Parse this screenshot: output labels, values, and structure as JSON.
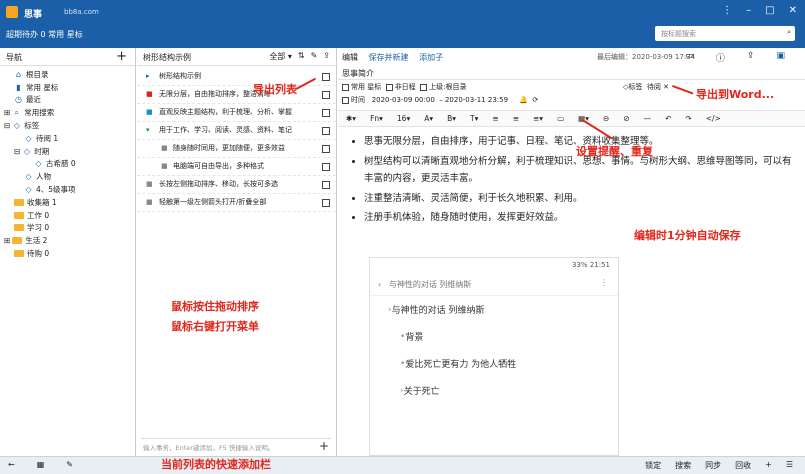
{
  "app": {
    "name": "思事",
    "domain": "bb8a.com",
    "links": "超期待办 0  常用 星标",
    "search_placeholder": "按标题搜索"
  },
  "left": {
    "header": "导航",
    "items": [
      {
        "icon": "home-icon",
        "label": "根目录",
        "indent": 1
      },
      {
        "icon": "bookmark-icon",
        "label": "常用 星标",
        "indent": 1
      },
      {
        "icon": "recent-icon",
        "label": "最近",
        "indent": 1
      },
      {
        "icon": "search-icon",
        "label": "常用搜索",
        "indent": 0,
        "prefix": "⊞"
      },
      {
        "icon": "tag-icon",
        "label": "标签",
        "indent": 0,
        "prefix": "⊟"
      },
      {
        "icon": "tag-icon",
        "label": "待阅 1",
        "indent": 2
      },
      {
        "icon": "tag-icon",
        "label": "时期",
        "indent": 1,
        "prefix": "⊟"
      },
      {
        "icon": "tag-icon",
        "label": "古希腊 0",
        "indent": 3
      },
      {
        "icon": "tag-icon",
        "label": "人物",
        "indent": 2
      },
      {
        "icon": "tag-icon",
        "label": "4、5级事项",
        "indent": 2
      },
      {
        "icon": "folder-icon",
        "label": "收集箱 1",
        "indent": 1
      },
      {
        "icon": "folder-icon",
        "label": "工作 0",
        "indent": 1
      },
      {
        "icon": "folder-icon",
        "label": "学习 0",
        "indent": 1
      },
      {
        "icon": "folder-icon",
        "label": "生活 2",
        "indent": 0,
        "prefix": "⊞"
      },
      {
        "icon": "folder-icon",
        "label": "待购 0",
        "indent": 1
      }
    ]
  },
  "mid": {
    "header": "树形结构示例",
    "filter": "全部 ▾",
    "quick_add_placeholder": "输入事务，Enter键添加，F5 快捷输入说明。",
    "rows": [
      {
        "bullet": "▸",
        "color": "#1a5fa8",
        "text": "树形结构示例",
        "indent": 0
      },
      {
        "bullet": "■",
        "color": "#d22",
        "text": "无限分层，自由拖动排序，整洁清晰",
        "indent": 0
      },
      {
        "bullet": "■",
        "color": "#1a8fd2",
        "text": "直观反映主题结构，利于梳理、分析、掌握",
        "indent": 0
      },
      {
        "bullet": "▾",
        "color": "#2a8a2a",
        "text": "用于工作、学习、阅读、灵感、资料、笔记",
        "indent": 0
      },
      {
        "bullet": "■",
        "color": "#888",
        "text": "随身随时同用，更加随便，更多效益",
        "indent": 1
      },
      {
        "bullet": "■",
        "color": "#888",
        "text": "电脑端可自由导出，多种格式",
        "indent": 1
      },
      {
        "bullet": "■",
        "color": "#888",
        "text": "长按左侧拖动排序、移动，长按可多选",
        "indent": 0
      },
      {
        "bullet": "■",
        "color": "#888",
        "text": "轻触第一级左侧箭头打开/折叠全部",
        "indent": 0
      }
    ]
  },
  "right": {
    "tab_edit": "编辑",
    "save_new": "保存并新建",
    "add_child": "添加子",
    "meta": "最后编辑：2020-03-09 17:34",
    "note_title": "思事简介",
    "attrs": {
      "common": "常用 星标",
      "no_date": "非日程",
      "parent": "上级:根目录",
      "tag": "标签",
      "tag_value": "待阅"
    },
    "time_label": "时间",
    "time_start": "2020-03-09 00:00",
    "time_end": "2020-03-11 23:59",
    "toolbar": [
      "✱▾",
      "Fn▾",
      "16▾",
      "A▾",
      "B▾",
      "T▾",
      "≡",
      "≡",
      "≡▾",
      "▭",
      "▦▾",
      "⊖",
      "⊘",
      "—",
      "↶",
      "↷",
      "</>"
    ],
    "bullets": [
      "思事无限分层，自由排序，用于记事、日程、笔记、资料收集整理等。",
      "树型结构可以清晰直观地分析分解，利于梳理知识、思想、事情。与树形大纲、思维导图等同，可以有丰富的内容，更灵活丰富。",
      "注重整洁清晰、灵活简便，利于长久地积累、利用。",
      "注册手机体验，随身随时使用，发挥更好效益。"
    ],
    "phone": {
      "time": "21:51",
      "battery": "33%",
      "back": "‹",
      "path": "与神性的对话 列维纳斯",
      "rows": [
        "与神性的对话 列维纳斯",
        "背景",
        "爱比死亡更有力 为他人牺牲",
        "关于死亡"
      ]
    }
  },
  "statusbar": {
    "left": [
      "←",
      "▦",
      "✎"
    ],
    "right": [
      "锁定",
      "搜索",
      "同步",
      "回收",
      "+",
      "☰"
    ]
  },
  "annotations": {
    "export_list": "导出列表",
    "export_word": "导出到Word...",
    "reminder": "设置提醒、重复",
    "autosave": "编辑时1分钟自动保存",
    "drag": "鼠标按住拖动排序",
    "rightclick": "鼠标右键打开菜单",
    "quickadd": "当前列表的快速添加栏"
  },
  "accent": "#1a5fa8",
  "annotation_color": "#e3261b"
}
